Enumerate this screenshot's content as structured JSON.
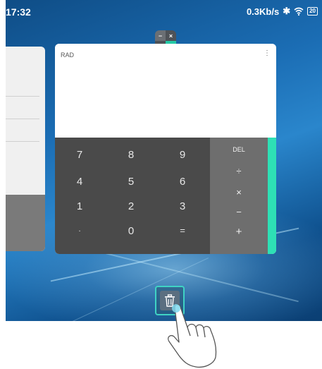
{
  "statusbar": {
    "time": "17:32",
    "network_speed": "0.3Kb/s",
    "bluetooth_icon": "bluetooth-icon",
    "wifi_icon": "wifi-icon",
    "battery": "20"
  },
  "calculator": {
    "app_icon": "calculator-app-icon",
    "mode": "RAD",
    "menu": "⋮",
    "icon_symbols": [
      "−",
      "×",
      "+",
      "="
    ],
    "keys": [
      [
        "7",
        "8",
        "9"
      ],
      [
        "4",
        "5",
        "6"
      ],
      [
        "1",
        "2",
        "3"
      ],
      [
        ".",
        "0",
        "="
      ]
    ],
    "operators": [
      "DEL",
      "÷",
      "×",
      "−",
      "+"
    ],
    "accent_color": "#2ee0b5"
  },
  "trash": {
    "icon": "trash-icon",
    "highlight_color": "#3fd3c4"
  }
}
